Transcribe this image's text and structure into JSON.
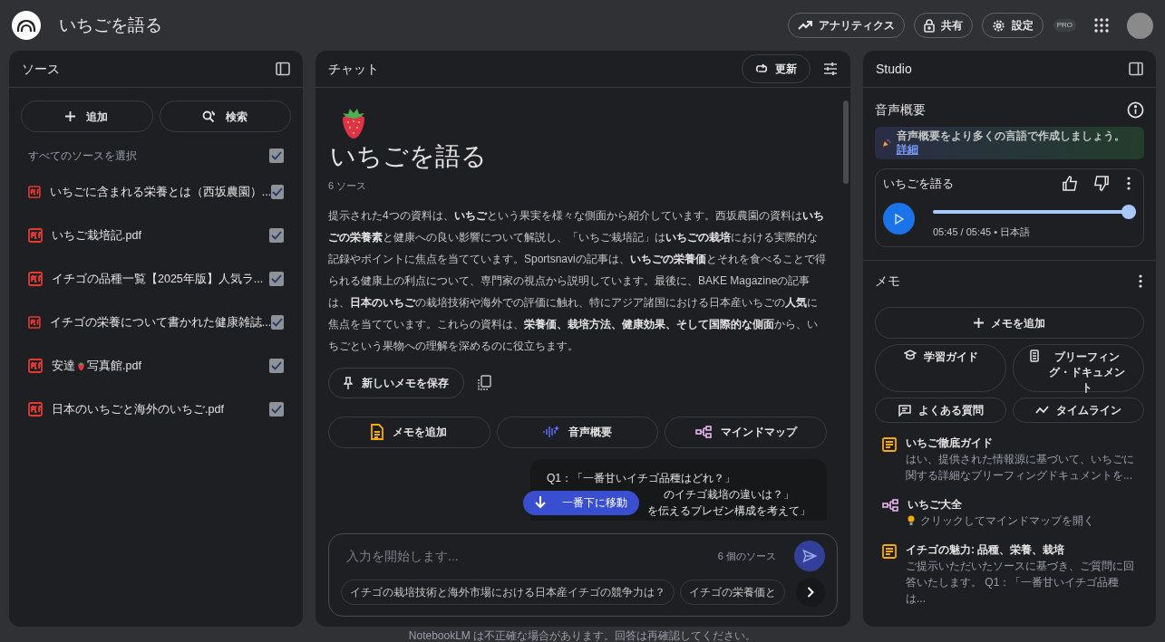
{
  "header": {
    "title": "いちごを語る",
    "buttons": [
      {
        "label": "アナリティクス",
        "kind": "analytics"
      },
      {
        "label": "共有",
        "kind": "share"
      },
      {
        "label": "設定",
        "kind": "settings"
      }
    ],
    "badge": "PRO"
  },
  "sources": {
    "title": "ソース",
    "actions": [
      {
        "label": "追加",
        "kind": "add"
      },
      {
        "label": "検索",
        "kind": "search"
      }
    ],
    "select_all": {
      "label": "すべてのソースを選択",
      "checked": true
    },
    "items": [
      {
        "name": [
          "いちごに含まれる栄養とは（西坂農園）..."
        ],
        "checked": true
      },
      {
        "name": [
          "いちご栽培記.pdf"
        ],
        "checked": true
      },
      {
        "name": [
          "イチゴの品種一覧【2025年版】人気ラ..."
        ],
        "checked": true
      },
      {
        "name": [
          "イチゴの栄養について書かれた健康雑誌..."
        ],
        "checked": true
      },
      {
        "name": [
          "安達",
          "写真館.pdf"
        ],
        "checked": true
      },
      {
        "name": [
          "日本のいちごと海外のいちご.pdf"
        ],
        "checked": true
      }
    ]
  },
  "chat": {
    "title": "チャット",
    "refresh": "更新",
    "notebook_title": "いちごを語る",
    "source_count": "6 ソース",
    "summary": "提示された4つの資料は、**いちご**という果実を様々な側面から紹介しています。西坂農園の資料は**いちごの栄養素**と健康への良い影響について解説し、「いちご栽培記」は**いちごの栽培**における実際的な記録やポイントに焦点を当てています。Sportsnaviの記事は、**いちごの栄養価**とそれを食べることで得られる健康上の利点について、専門家の視点から説明しています。最後に、BAKE Magazineの記事は、**日本のいちご**の栽培技術や海外での評価に触れ、特にアジア諸国における日本産いちごの**人気**に焦点を当てています。これらの資料は、**栄養価、栽培方法、健康効果、そして国際的な側面**から、いちごという果物への理解を深めるのに役立ちます。",
    "save_note": "新しいメモを保存",
    "actions": [
      {
        "label": "メモを追加",
        "kind": "note"
      },
      {
        "label": "音声概要",
        "kind": "audio"
      },
      {
        "label": "マインドマップ",
        "kind": "mindmap"
      }
    ],
    "message_lines": [
      "Q1：「一番甘いイチゴ品種はどれ？」",
      "のイチゴ栽培の違いは？」",
      "を伝えるプレゼン構成を考えて」"
    ],
    "jump": "一番下に移動",
    "placeholder": "入力を開始します...",
    "input_sources": "6 個のソース",
    "suggestions": [
      "イチゴの栽培技術と海外市場における日本産イチゴの競争力は？",
      "イチゴの栄養価と"
    ]
  },
  "studio": {
    "title": "Studio",
    "audio_title": "音声概要",
    "banner": "音声概要をより多くの言語で作成しましょう。",
    "banner_link": "詳細",
    "audio": {
      "title": "いちごを語る",
      "level": 1,
      "time": "05:45 / 05:45 • 日本語"
    },
    "notes_title": "メモ",
    "add_note": "メモを追加",
    "tools": [
      {
        "label": "学習ガイド",
        "kind": "study"
      },
      {
        "label": "ブリーフィング・ドキュメント",
        "kind": "briefing"
      },
      {
        "label": "よくある質問",
        "kind": "faq"
      },
      {
        "label": "タイムライン",
        "kind": "timeline"
      }
    ],
    "notes": [
      {
        "kind": "note",
        "title": "いちご徹底ガイド",
        "text": "はい、提供された情報源に基づいて、いちごに関する詳細なブリーフィングドキュメントを..."
      },
      {
        "kind": "mindmap",
        "title": "いちご大全",
        "text": "クリックしてマインドマップを開く"
      },
      {
        "kind": "note",
        "title": "イチゴの魅力: 品種、栄養、栽培",
        "text": "ご提示いただいたソースに基づき、ご質問に回答いたします。 Q1：「一番甘いイチゴ品種は..."
      }
    ]
  },
  "footer": "NotebookLM は不正確な場合があります。回答は再確認してください。"
}
